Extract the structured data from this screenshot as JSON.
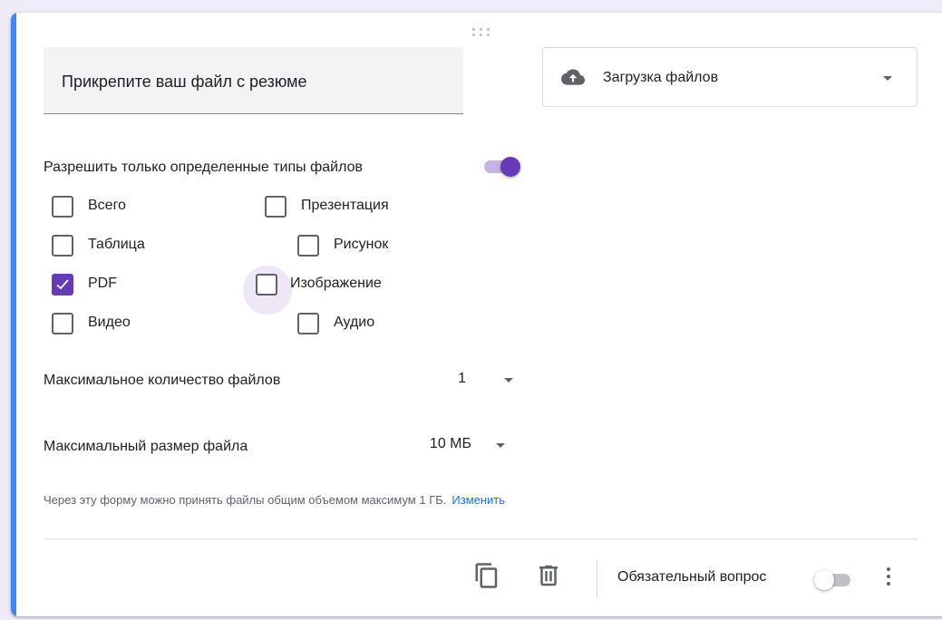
{
  "question": {
    "title": "Прикрепите ваш файл с резюме",
    "type_label": "Загрузка файлов"
  },
  "file_types": {
    "restrict_label": "Разрешить только определенные типы файлов",
    "restrict_enabled": true,
    "options": [
      {
        "label": "Всего",
        "checked": false
      },
      {
        "label": "Презентация",
        "checked": false
      },
      {
        "label": "Таблица",
        "checked": false
      },
      {
        "label": "Рисунок",
        "checked": false
      },
      {
        "label": "PDF",
        "checked": true
      },
      {
        "label": "Изображение",
        "checked": false
      },
      {
        "label": "Видео",
        "checked": false
      },
      {
        "label": "Аудио",
        "checked": false
      }
    ]
  },
  "limits": {
    "max_files_label": "Максимальное количество файлов",
    "max_files_value": "1",
    "max_size_label": "Максимальный размер файла",
    "max_size_value": "10 МБ"
  },
  "note": {
    "text": "Через эту форму можно принять файлы общим объемом максимум 1 ГБ.",
    "link": "Изменить"
  },
  "footer": {
    "required_label": "Обязательный вопрос",
    "required_enabled": false
  },
  "colors": {
    "accent": "#4285f4",
    "brand": "#673ab7",
    "link": "#1a73e8"
  }
}
